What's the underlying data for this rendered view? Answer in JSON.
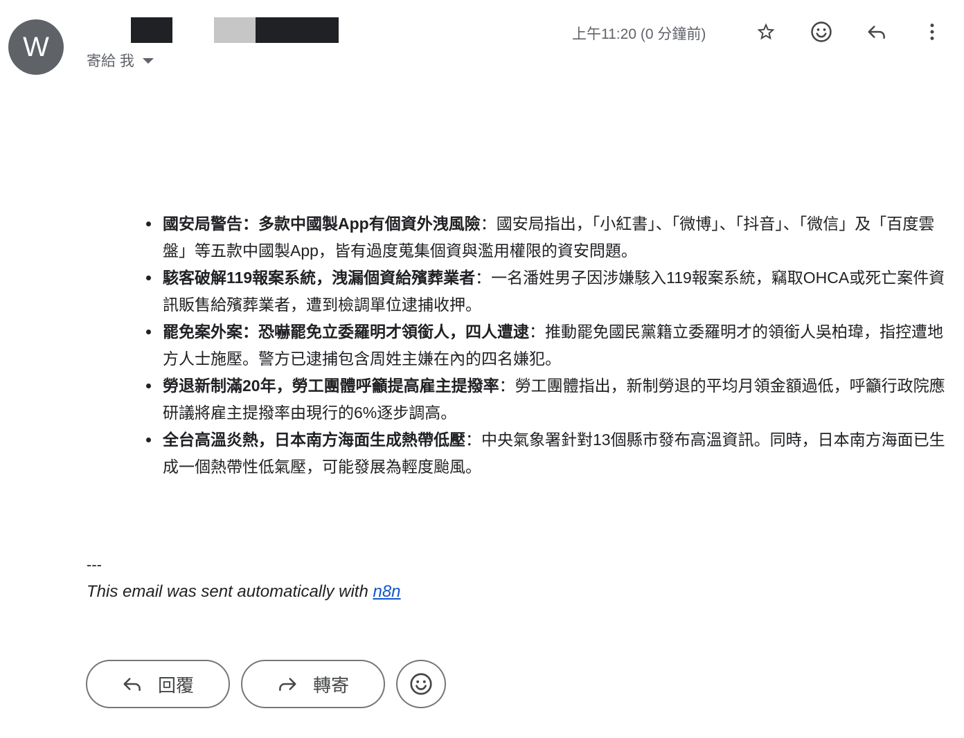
{
  "sender": {
    "avatar_letter": "W"
  },
  "recipient": {
    "label": "寄給 我"
  },
  "header": {
    "timestamp": "上午11:20 (0 分鐘前)",
    "icons": [
      "star-icon",
      "emoji-icon",
      "reply-icon",
      "more-vert-icon"
    ]
  },
  "body": {
    "items": [
      {
        "title": "國安局警告：多款中國製App有個資外洩風險",
        "text": "：國安局指出，「小紅書」、「微博」、「抖音」、「微信」及「百度雲盤」等五款中國製App，皆有過度蒐集個資與濫用權限的資安問題。"
      },
      {
        "title": "駭客破解119報案系統，洩漏個資給殯葬業者",
        "text": "：一名潘姓男子因涉嫌駭入119報案系統，竊取OHCA或死亡案件資訊販售給殯葬業者，遭到檢調單位逮捕收押。"
      },
      {
        "title": "罷免案外案：恐嚇罷免立委羅明才領銜人，四人遭逮",
        "text": "：推動罷免國民黨籍立委羅明才的領銜人吳柏瑋，指控遭地方人士施壓。警方已逮捕包含周姓主嫌在內的四名嫌犯。"
      },
      {
        "title": "勞退新制滿20年，勞工團體呼籲提高雇主提撥率",
        "text": "：勞工團體指出，新制勞退的平均月領金額過低，呼籲行政院應研議將雇主提撥率由現行的6%逐步調高。"
      },
      {
        "title": "全台高溫炎熱，日本南方海面生成熱帶低壓",
        "text": "：中央氣象署針對13個縣市發布高溫資訊。同時，日本南方海面已生成一個熱帶性低氣壓，可能發展為輕度颱風。"
      }
    ]
  },
  "signature": {
    "separator": "---",
    "text": "This email was sent automatically with ",
    "link_text": "n8n"
  },
  "actions": {
    "reply_label": "回覆",
    "forward_label": "轉寄"
  },
  "colors": {
    "avatar_bg": "#5f6368",
    "link": "#1155cc",
    "muted_text": "#5f6368"
  }
}
